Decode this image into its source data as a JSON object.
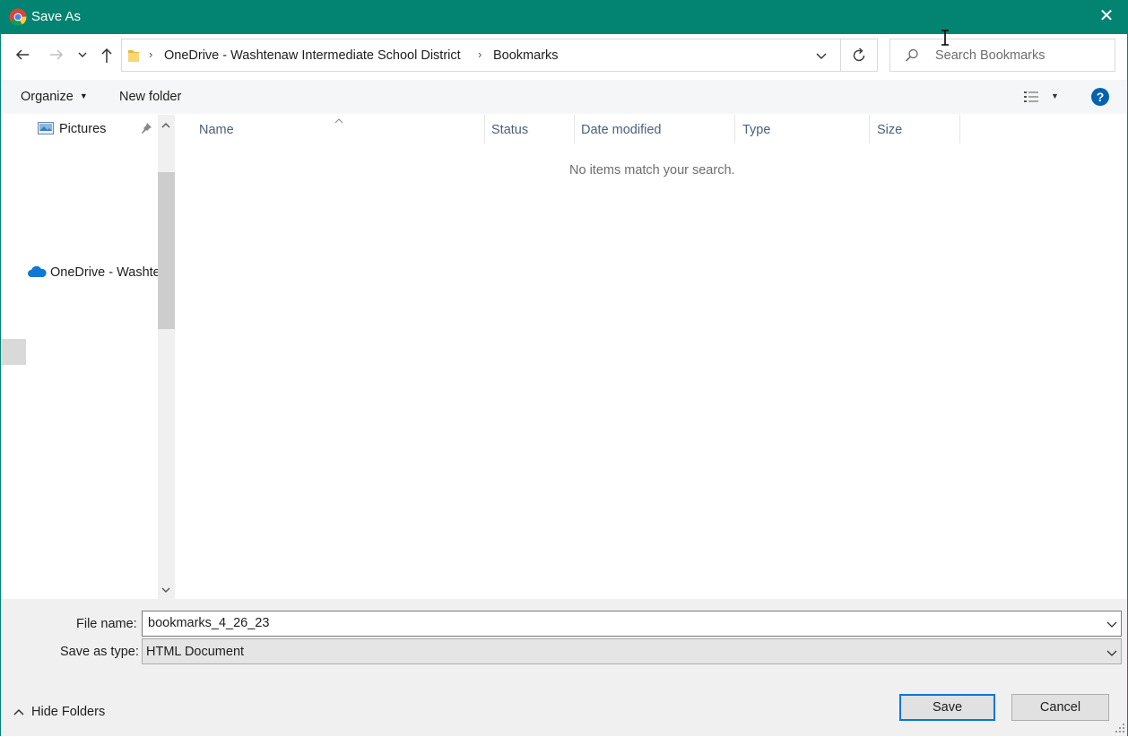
{
  "window": {
    "title": "Save As",
    "accent": "#038472"
  },
  "address": {
    "path": [
      "OneDrive - Washtenaw Intermediate School District",
      "Bookmarks"
    ]
  },
  "search": {
    "placeholder": "Search Bookmarks"
  },
  "toolbar": {
    "organize_label": "Organize",
    "new_folder_label": "New folder"
  },
  "nav": {
    "items": [
      {
        "label": "Pictures",
        "icon": "pictures-icon"
      },
      {
        "label": "OneDrive - Washte",
        "icon": "onedrive-icon"
      }
    ]
  },
  "columns": [
    "Name",
    "Status",
    "Date modified",
    "Type",
    "Size"
  ],
  "empty_message": "No items match your search.",
  "form": {
    "file_name_label": "File name:",
    "file_name_value": "bookmarks_4_26_23",
    "save_type_label": "Save as type:",
    "save_type_value": "HTML Document"
  },
  "footer": {
    "hide_folders_label": "Hide Folders",
    "save_label": "Save",
    "cancel_label": "Cancel"
  }
}
